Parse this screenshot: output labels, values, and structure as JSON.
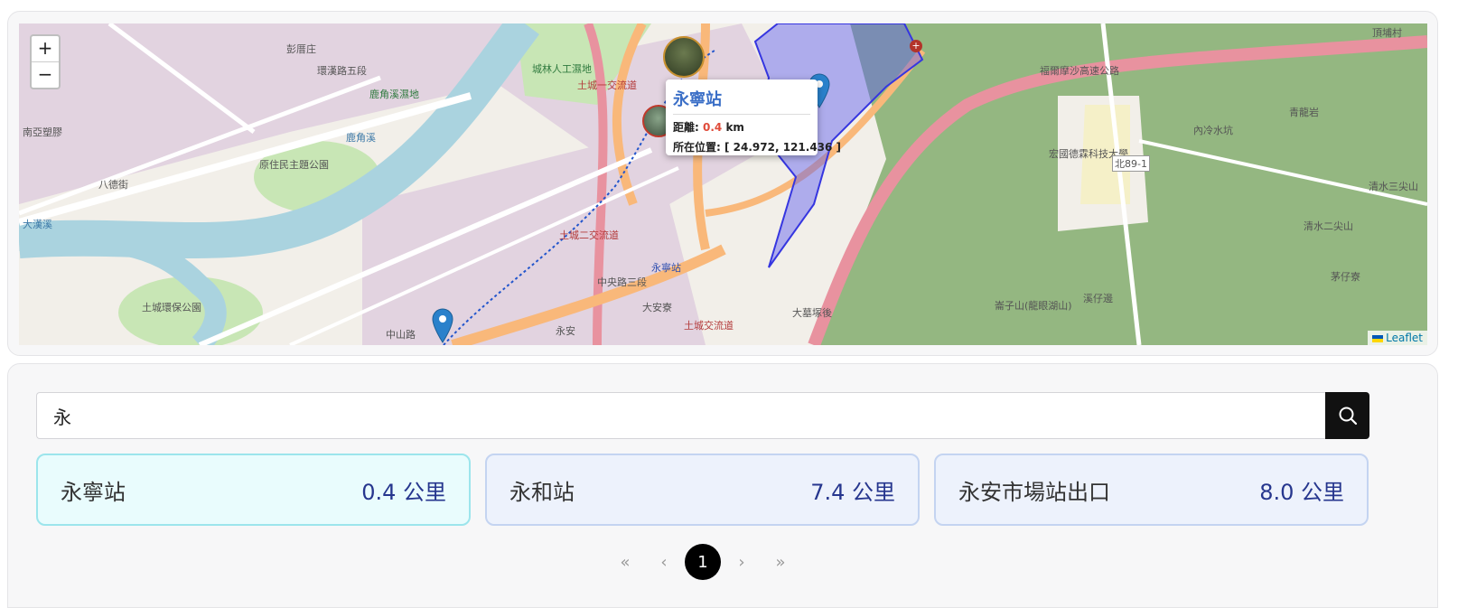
{
  "map": {
    "zoom_in_label": "+",
    "zoom_out_label": "−",
    "attribution": "Leaflet",
    "labels": [
      "南亞塑膠",
      "大漢溪",
      "八德街",
      "環漢路五段",
      "鹿角溪濕地",
      "鹿角溪",
      "城林人工濕地",
      "土城一交流道",
      "永寧站",
      "土城二交流道",
      "中央路三段",
      "大安寮",
      "土城交流道",
      "福爾摩沙高速公路",
      "宏國德霖科技大學",
      "內冷水坑",
      "青龍岩",
      "清水二尖山",
      "茅仔寮",
      "溪仔邊",
      "大墓塚後",
      "崙子山(龍眼湖山)",
      "北89-1",
      "原住民主題公園",
      "土城環保公園",
      "彭厝庄",
      "頂埔村",
      "清水三尖山",
      "永安",
      "中山路"
    ],
    "colors": {
      "land": "#f2efe9",
      "residential": "#e2d3e0",
      "water": "#aad3df",
      "park": "#c8e6b5",
      "forest": "#84ad6f",
      "highway": "#e8929f",
      "trunk": "#f9b87a",
      "selection": "#5c5cf0"
    }
  },
  "popup": {
    "title": "永寧站",
    "distance_label": "距離:",
    "distance_value": "0.4",
    "distance_unit": "km",
    "location_label": "所在位置:",
    "location_value": "[ 24.972, 121.436 ]"
  },
  "search": {
    "value": "永",
    "button_icon": "search-icon"
  },
  "results": [
    {
      "name": "永寧站",
      "distance": "0.4 公里",
      "active": true
    },
    {
      "name": "永和站",
      "distance": "7.4 公里",
      "active": false
    },
    {
      "name": "永安市場站出口",
      "distance": "8.0 公里",
      "active": false
    }
  ],
  "pagination": {
    "first": "«",
    "prev": "‹",
    "current": "1",
    "next": "›",
    "last": "»"
  }
}
